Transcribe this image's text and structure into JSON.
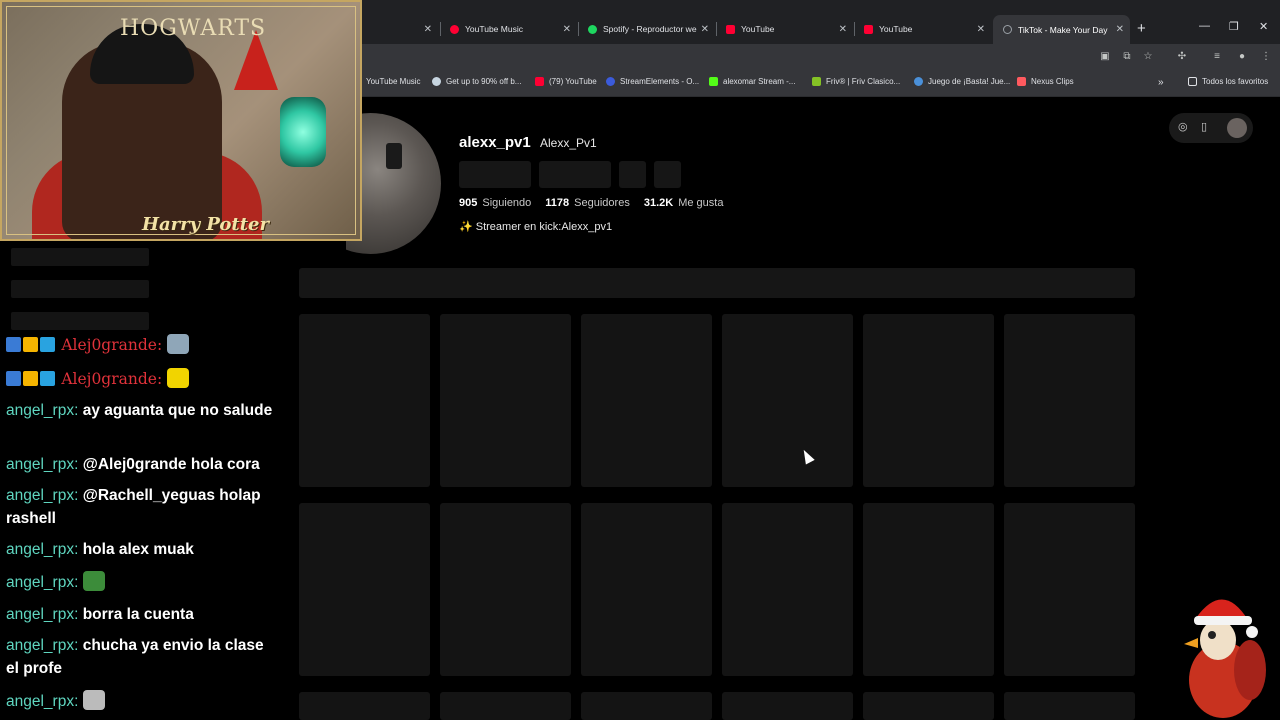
{
  "browser": {
    "tabs": [
      {
        "label": "",
        "color": "#5f6368",
        "active": false
      },
      {
        "label": "YouTube Music",
        "color": "#ff0033",
        "active": false
      },
      {
        "label": "Spotify - Reproductor we",
        "color": "#1ed760",
        "active": false
      },
      {
        "label": "YouTube",
        "color": "#ff0033",
        "active": false
      },
      {
        "label": "YouTube",
        "color": "#ff0033",
        "active": false
      },
      {
        "label": "TikTok - Make Your Day",
        "color": "#9aa0a6",
        "active": true
      }
    ],
    "new_tab_icon": "plus-icon",
    "bookmarks": [
      {
        "label": "YouTube Music",
        "color": "#ff0033"
      },
      {
        "label": "Get up to 90% off b...",
        "color": "#1b2838"
      },
      {
        "label": "(79) YouTube",
        "color": "#ff0033"
      },
      {
        "label": "StreamElements - O...",
        "color": "#3b5bdb"
      },
      {
        "label": "alexomar Stream -...",
        "color": "#53fc18"
      },
      {
        "label": "Friv® | Friv Clasico...",
        "color": "#84c225"
      },
      {
        "label": "Juego de ¡Basta! Jue...",
        "color": "#4a90d9"
      },
      {
        "label": "Nexus Clips",
        "color": "#ff5a5f"
      }
    ],
    "all_bookmarks": "Todos los favoritos"
  },
  "profile": {
    "username": "alexx_pv1",
    "nickname": "Alexx_Pv1",
    "following_count": "905",
    "following_label": "Siguiendo",
    "followers_count": "1178",
    "followers_label": "Seguidores",
    "likes_count": "31.2K",
    "likes_label": "Me gusta",
    "bio": "✨ Streamer en kick:Alexx_pv1"
  },
  "overlay": {
    "webcam_title": "HOGWARTS",
    "webcam_caption": "Harry Potter"
  },
  "chat": [
    {
      "user": "Alej0grande:",
      "message": "",
      "style": "red",
      "emote": "#8fa6b8"
    },
    {
      "user": "Alej0grande:",
      "message": "",
      "style": "red",
      "emote": "#f1d400"
    },
    {
      "user": "angel_rpx:",
      "message": "ay aguanta que no salude",
      "style": "teal"
    },
    {
      "user": "angel_rpx:",
      "message": "@Alej0grande hola cora",
      "style": "teal"
    },
    {
      "user": "angel_rpx:",
      "message": "@Rachell_yeguas holap rashell",
      "style": "teal"
    },
    {
      "user": "angel_rpx:",
      "message": "hola alex muak",
      "style": "teal"
    },
    {
      "user": "angel_rpx:",
      "message": "",
      "style": "teal",
      "emote": "#3c8c3a"
    },
    {
      "user": "angel_rpx:",
      "message": "borra la cuenta",
      "style": "teal"
    },
    {
      "user": "angel_rpx:",
      "message": "chucha ya envio la clase el profe",
      "style": "teal"
    },
    {
      "user": "angel_rpx:",
      "message": "",
      "style": "teal",
      "emote": "#bbbbbb"
    }
  ]
}
